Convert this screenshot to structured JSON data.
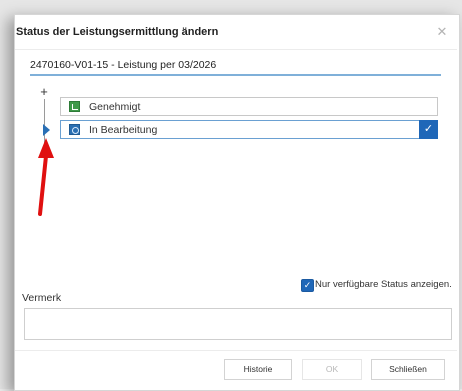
{
  "dialog": {
    "title": "Status der Leistungsermittlung ändern",
    "close_icon": "close-icon"
  },
  "subject": {
    "value": "2470160-V01-15 - Leistung per 03/2026"
  },
  "tree": {
    "add_icon": "plus-icon",
    "marker_icon": "triangle-right-icon"
  },
  "statuses": [
    {
      "label": "Genehmigt",
      "icon": "approved-icon",
      "icon_color": "#3f9a4a",
      "selected": false
    },
    {
      "label": "In Bearbeitung",
      "icon": "in-progress-icon",
      "icon_color": "#2b6fb2",
      "selected": true
    }
  ],
  "selected_check_icon": "checkmark-icon",
  "filter": {
    "label": "Nur verfügbare Status anzeigen.",
    "checked": true
  },
  "note": {
    "label": "Vermerk",
    "value": ""
  },
  "buttons": {
    "history": "Historie",
    "ok": "OK",
    "close": "Schließen"
  },
  "colors": {
    "accent": "#1f67b8",
    "annotation_arrow": "#e01010"
  }
}
